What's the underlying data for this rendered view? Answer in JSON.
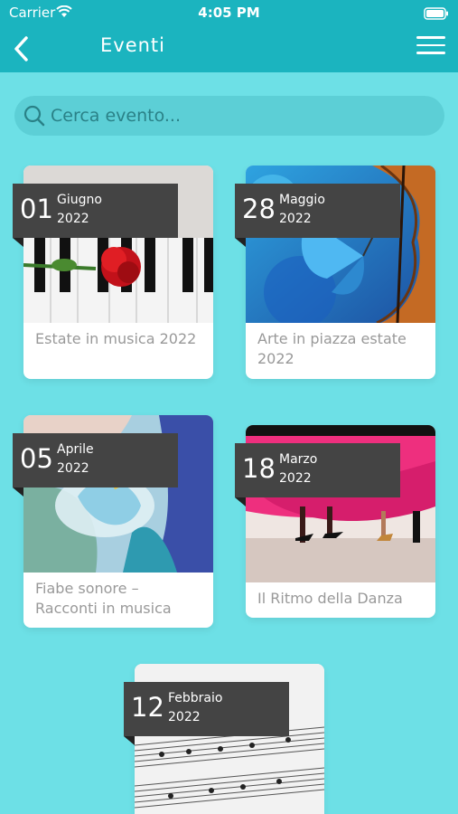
{
  "status_bar": {
    "carrier": "Carrier",
    "time": "4:05 PM"
  },
  "nav": {
    "title": "Eventi"
  },
  "search": {
    "placeholder": "Cerca evento..."
  },
  "events": [
    {
      "day": "01",
      "month": "Giugno",
      "year": "2022",
      "title": "Estate in musica 2022",
      "image": "piano-rose"
    },
    {
      "day": "28",
      "month": "Maggio",
      "year": "2022",
      "title": "Arte in piazza estate 2022",
      "image": "butterfly-violin"
    },
    {
      "day": "05",
      "month": "Aprile",
      "year": "2022",
      "title": "Fiabe sonore – Racconti in musica",
      "image": "painting-dancer"
    },
    {
      "day": "18",
      "month": "Marzo",
      "year": "2022",
      "title": "Il Ritmo della Danza",
      "image": "dance-skirts"
    },
    {
      "day": "12",
      "month": "Febbraio",
      "year": "2022",
      "title": "",
      "image": "sheet-music"
    }
  ],
  "colors": {
    "header": "#1bb4bf",
    "background": "#6de0e6",
    "badge": "#444444"
  }
}
